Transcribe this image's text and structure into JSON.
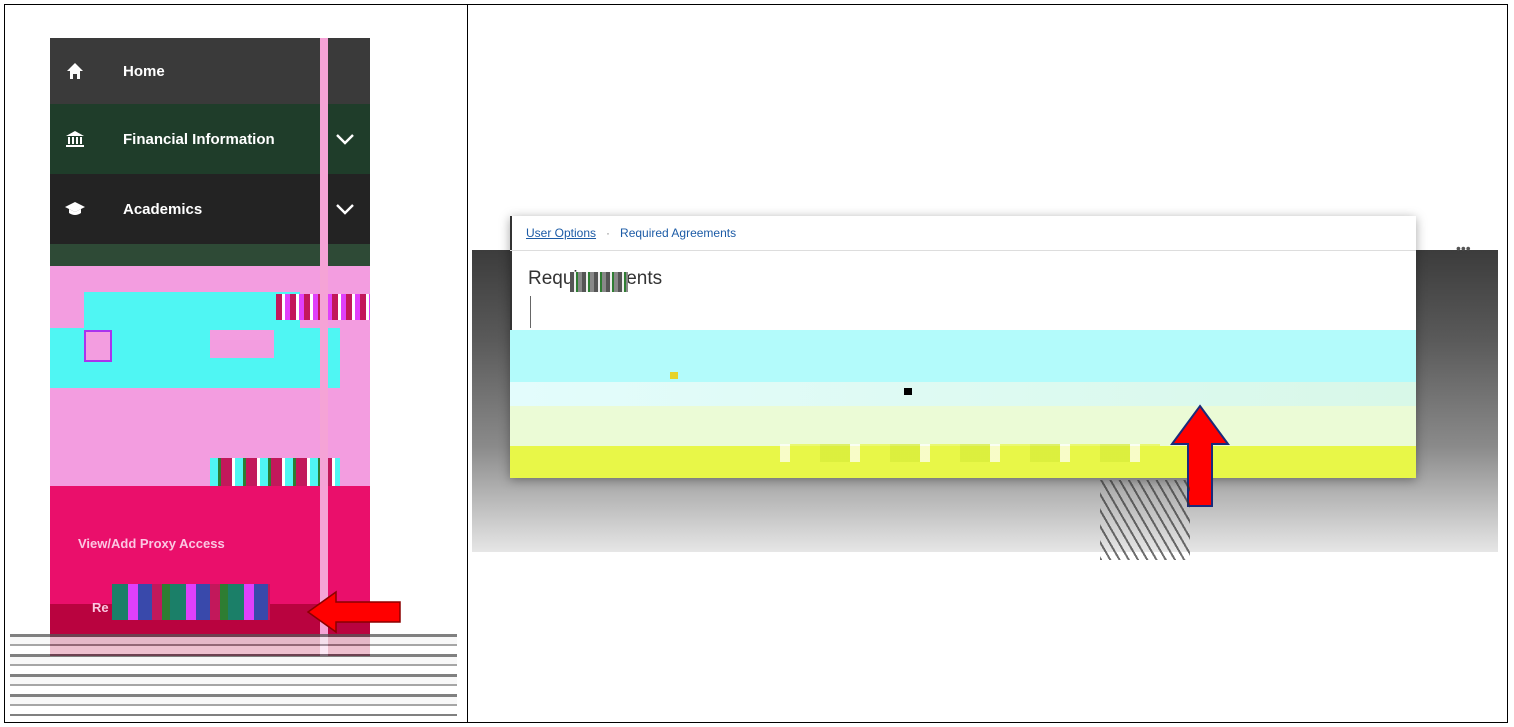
{
  "sidebar": {
    "items": [
      {
        "label": "Home",
        "icon": "home-icon",
        "expandable": false
      },
      {
        "label": "Financial Information",
        "icon": "bank-icon",
        "expandable": true
      },
      {
        "label": "Academics",
        "icon": "graduation-cap-icon",
        "expandable": true
      }
    ],
    "proxy_link": "View/Add Proxy Access",
    "required_agreements_partial": "Re"
  },
  "right_panel": {
    "breadcrumb": {
      "user_options": "User Options",
      "separator": "·",
      "current": "Required Agreements"
    },
    "page_title": "Requir          eements"
  },
  "annotations": {
    "arrow_color": "#ff0000",
    "arrows": [
      "left-pointing arrow",
      "up-pointing arrow"
    ]
  },
  "colors": {
    "home_bg": "#3a3a3a",
    "financial_bg": "#1f3d2a",
    "academics_bg": "#232323",
    "link_blue": "#1c5ba6"
  }
}
